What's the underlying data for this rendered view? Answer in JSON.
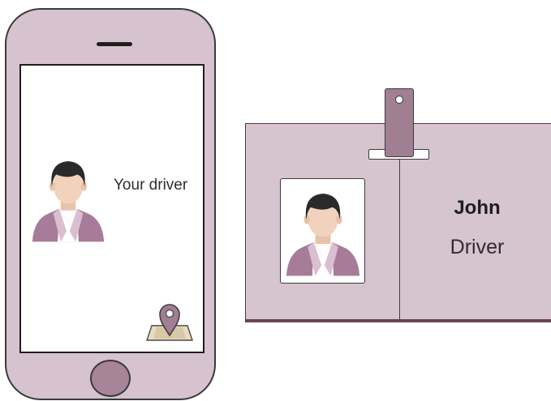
{
  "phone": {
    "caption": "Your driver",
    "icons": {
      "avatar": "person-avatar-icon",
      "location": "map-location-pin-icon",
      "home": "home-button"
    }
  },
  "badge": {
    "name": "John",
    "role": "Driver",
    "icons": {
      "photo": "person-avatar-icon",
      "clip": "badge-clip-icon"
    }
  },
  "colors": {
    "device": "#d6c3cf",
    "accent": "#a07f93",
    "dark_accent": "#6a4257",
    "avatar_hair": "#2a2a2a",
    "avatar_skin": "#f2d2bd",
    "avatar_jacket": "#a67c98"
  }
}
